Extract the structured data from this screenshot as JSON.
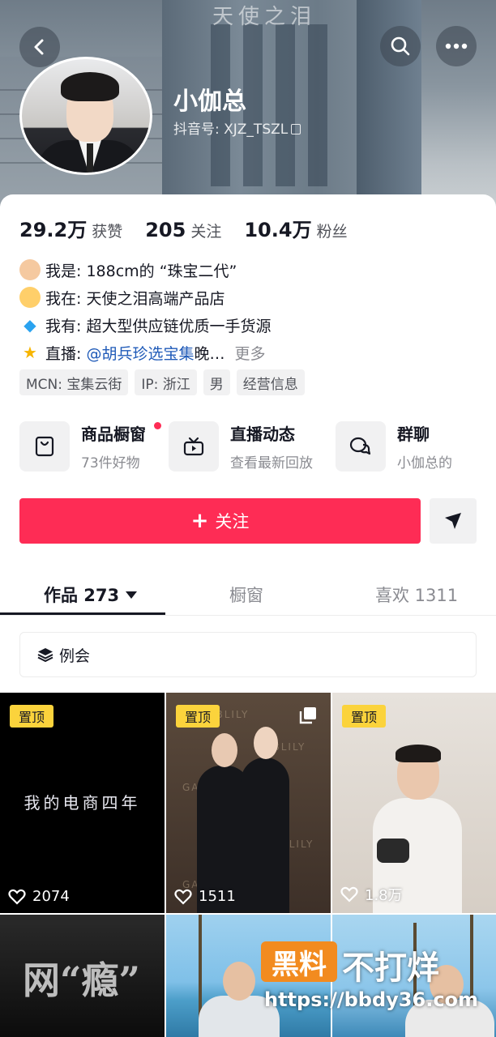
{
  "header": {
    "building_sign": "天使之泪",
    "username": "小伽总",
    "douyin_id": "抖音号: XJZ_TSZL"
  },
  "stats": [
    {
      "num": "29.2万",
      "label": "获赞"
    },
    {
      "num": "205",
      "label": "关注"
    },
    {
      "num": "10.4万",
      "label": "粉丝"
    }
  ],
  "bio": {
    "line1_label": "我是:",
    "line1_text": "188cm的 “珠宝二代”",
    "line2_label": "我在:",
    "line2_text": "天使之泪高端产品店",
    "line3_label": "我有:",
    "line3_text": "超大型供应链优质一手货源",
    "line4_label": "直播:",
    "line4_mention": "@胡兵珍选宝集",
    "line4_text": " 晚…",
    "more": "更多"
  },
  "tags": [
    "MCN: 宝集云街",
    "IP: 浙江",
    "男",
    "经营信息"
  ],
  "shortcuts": [
    {
      "title": "商品橱窗",
      "sub": "73件好物"
    },
    {
      "title": "直播动态",
      "sub": "查看最新回放"
    },
    {
      "title": "群聊",
      "sub": "小伽总的"
    }
  ],
  "follow": {
    "plus": "+",
    "label": "关注"
  },
  "tabs": [
    {
      "label": "作品 273"
    },
    {
      "label": "橱窗"
    },
    {
      "label": "喜欢 1311"
    }
  ],
  "collection": {
    "label": "例会"
  },
  "videos": [
    {
      "pinned": "置顶",
      "overlay": "我的电商四年",
      "likes": "2074"
    },
    {
      "pinned": "置顶",
      "brand": "GABLILY",
      "likes": "1511"
    },
    {
      "pinned": "置顶",
      "likes": "1.8万"
    },
    {
      "overlay": "网“瘾”"
    },
    {},
    {}
  ],
  "watermark": {
    "logo": "黑料",
    "title": "不打烊",
    "url": "https://bbdy36.com"
  },
  "colors": {
    "accent": "#fe2c55",
    "mention": "#1f5ab8",
    "pin_badge": "#fbd33c",
    "watermark_orange": "#f28b1f"
  }
}
